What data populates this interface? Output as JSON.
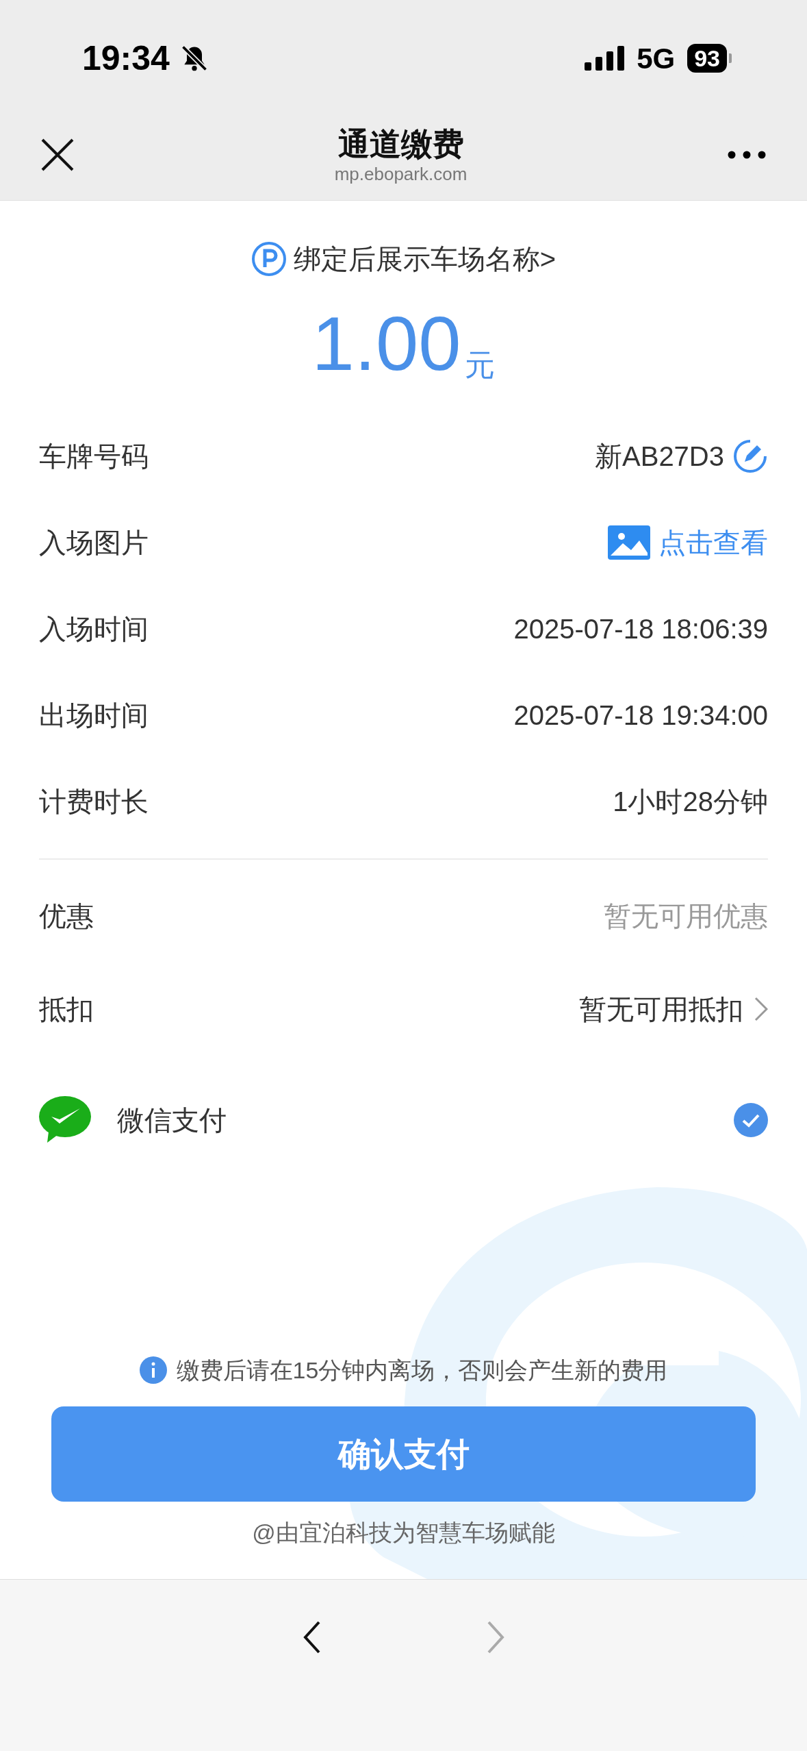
{
  "status_bar": {
    "time": "19:34",
    "network": "5G",
    "battery": "93"
  },
  "header": {
    "title": "通道缴费",
    "url": "mp.ebopark.com"
  },
  "lot_link": "绑定后展示车场名称>",
  "amount": {
    "value": "1.00",
    "unit": "元"
  },
  "details": [
    {
      "kind": "plate",
      "label": "车牌号码",
      "value": "新AB27D3"
    },
    {
      "kind": "photo",
      "label": "入场图片",
      "value": "点击查看"
    },
    {
      "kind": "text",
      "label": "入场时间",
      "value": "2025-07-18 18:06:39"
    },
    {
      "kind": "text",
      "label": "出场时间",
      "value": "2025-07-18 19:34:00"
    },
    {
      "kind": "text",
      "label": "计费时长",
      "value": "1小时28分钟"
    }
  ],
  "discounts": [
    {
      "kind": "text",
      "label": "优惠",
      "value": "暂无可用优惠"
    },
    {
      "kind": "link",
      "label": "抵扣",
      "value": "暂无可用抵扣"
    }
  ],
  "payment": {
    "name": "微信支付",
    "selected": true
  },
  "notice": "缴费后请在15分钟内离场，否则会产生新的费用",
  "confirm_button": "确认支付",
  "footer": "@由宜泊科技为智慧车场赋能",
  "nav": {
    "back": {
      "disabled": false
    },
    "forward": {
      "disabled": true
    }
  }
}
